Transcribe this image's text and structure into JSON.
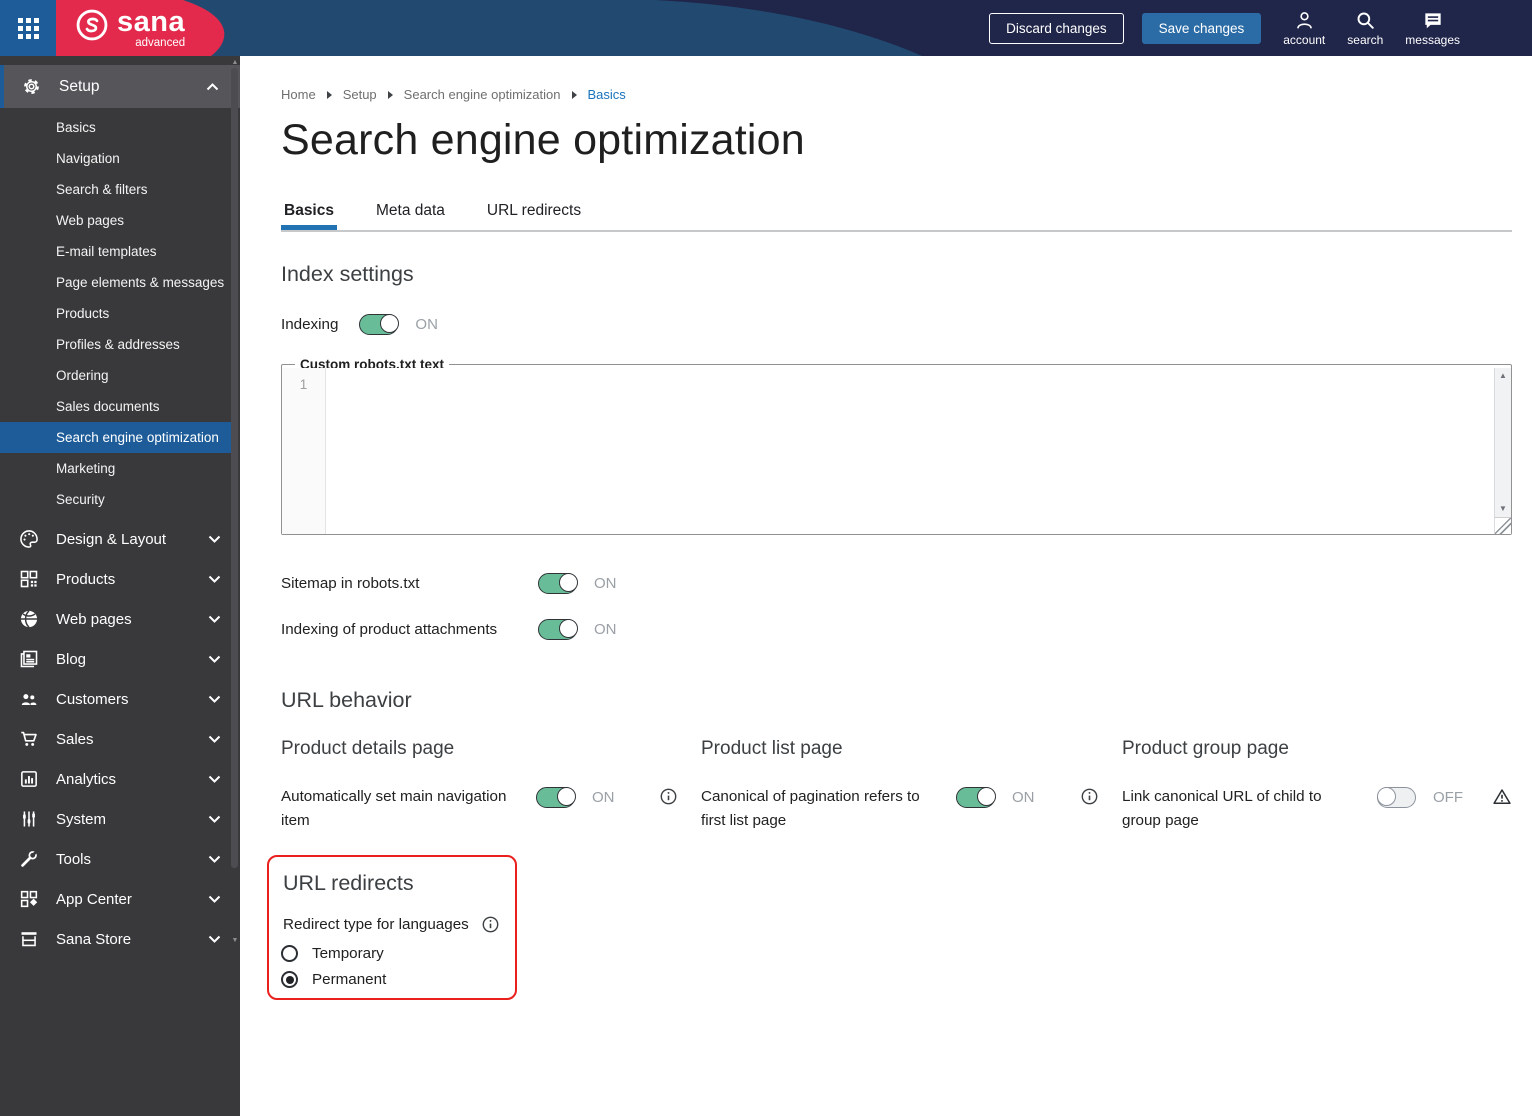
{
  "colors": {
    "topbar_bg": "#20254a",
    "topbar_curve_blue": "#224a70",
    "brand_red": "#e32a4c",
    "app_square_blue": "#1d5c99",
    "sidebar_bg": "#39393b",
    "sidebar_header_bg": "#56565a",
    "selected_item_blue": "#1d5c99",
    "save_button_blue": "#2b6ca6",
    "tab_accent_blue": "#2173b4",
    "breadcrumb_link_blue": "#1a73bc",
    "toggle_on_green": "#68bd98",
    "highlight_red": "#ea201d"
  },
  "topbar": {
    "brand_name": "sana",
    "brand_sub": "advanced",
    "discard_button": "Discard changes",
    "save_button": "Save changes",
    "account_label": "account",
    "search_label": "search",
    "messages_label": "messages"
  },
  "sidebar": {
    "setup_label": "Setup",
    "setup_items": [
      "Basics",
      "Navigation",
      "Search & filters",
      "Web pages",
      "E-mail templates",
      "Page elements & messages",
      "Products",
      "Profiles & addresses",
      "Ordering",
      "Sales documents",
      "Search engine optimization",
      "Marketing",
      "Security"
    ],
    "selected_item": "Search engine optimization",
    "sections": [
      {
        "label": "Design & Layout",
        "icon": "palette-icon"
      },
      {
        "label": "Products",
        "icon": "products-icon"
      },
      {
        "label": "Web pages",
        "icon": "globe-icon"
      },
      {
        "label": "Blog",
        "icon": "blog-icon"
      },
      {
        "label": "Customers",
        "icon": "customers-icon"
      },
      {
        "label": "Sales",
        "icon": "cart-icon"
      },
      {
        "label": "Analytics",
        "icon": "analytics-icon"
      },
      {
        "label": "System",
        "icon": "sliders-icon"
      },
      {
        "label": "Tools",
        "icon": "wrench-icon"
      },
      {
        "label": "App Center",
        "icon": "app-center-icon"
      },
      {
        "label": "Sana Store",
        "icon": "store-icon"
      }
    ]
  },
  "breadcrumb": [
    "Home",
    "Setup",
    "Search engine optimization",
    "Basics"
  ],
  "page_title": "Search engine optimization",
  "tabs": [
    {
      "label": "Basics",
      "active": true
    },
    {
      "label": "Meta data",
      "active": false
    },
    {
      "label": "URL redirects",
      "active": false
    }
  ],
  "index_settings": {
    "heading": "Index settings",
    "indexing_label": "Indexing",
    "indexing_state": "ON",
    "robots_label": "Custom robots.txt text",
    "robots_line_number": "1",
    "robots_value": "",
    "sitemap_label": "Sitemap in robots.txt",
    "sitemap_state": "ON",
    "attachments_label": "Indexing of product attachments",
    "attachments_state": "ON"
  },
  "url_behavior": {
    "heading": "URL behavior",
    "columns": [
      {
        "heading": "Product details page",
        "setting": "Automatically set main navigation item",
        "state": "ON",
        "icon": "info-icon"
      },
      {
        "heading": "Product list page",
        "setting": "Canonical of pagination refers to first list page",
        "state": "ON",
        "icon": "info-icon"
      },
      {
        "heading": "Product group page",
        "setting": "Link canonical URL of child to group page",
        "state": "OFF",
        "icon": "warning-icon"
      }
    ]
  },
  "url_redirects": {
    "heading": "URL redirects",
    "type_label": "Redirect type for languages",
    "options": [
      {
        "label": "Temporary",
        "selected": false
      },
      {
        "label": "Permanent",
        "selected": true
      }
    ]
  }
}
